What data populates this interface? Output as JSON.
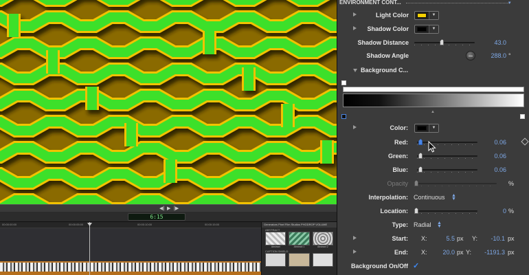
{
  "inspector": {
    "header": "ENVIRONMENT CONT...",
    "light_color": {
      "label": "Light Color",
      "color": "#f5d000"
    },
    "shadow_color": {
      "label": "Shadow Color",
      "color": "#000000"
    },
    "shadow_distance": {
      "label": "Shadow Distance",
      "value": "43.0",
      "slider_fraction": 0.46
    },
    "shadow_angle": {
      "label": "Shadow Angle",
      "value": "288.0",
      "unit": "°"
    },
    "background_color_section": {
      "label": "Background C..."
    },
    "color": {
      "label": "Color:",
      "color": "#000000"
    },
    "red": {
      "label": "Red:",
      "value": "0.06",
      "slider_fraction": 0.06
    },
    "green": {
      "label": "Green:",
      "value": "0.06",
      "slider_fraction": 0.06
    },
    "blue": {
      "label": "Blue:",
      "value": "0.06",
      "slider_fraction": 0.06
    },
    "opacity": {
      "label": "Opacity",
      "unit": "%"
    },
    "interpolation": {
      "label": "Interpolation:",
      "value": "Continuous"
    },
    "location": {
      "label": "Location:",
      "value": "0",
      "unit": "%"
    },
    "type": {
      "label": "Type:",
      "value": "Radial"
    },
    "start": {
      "label": "Start:",
      "x_label": "X:",
      "x": "5.5",
      "y_label": "Y:",
      "y": "-10.1",
      "unit": "px"
    },
    "end": {
      "label": "End:",
      "x_label": "X:",
      "x": "20.0",
      "y_label": "Y:",
      "y": "-1191.3",
      "unit": "px"
    },
    "background_onoff": {
      "label": "Background On/Off",
      "checked": true
    }
  },
  "viewer": {
    "timecode": "6:15",
    "colors": {
      "pattern": "#3ee02a",
      "edge": "#f2c200",
      "shadow": "#1a1400"
    }
  },
  "browser": {
    "header": "Generators   Pixel Film Studios  PHODROP VOLUME",
    "section1": "ABSTRACT",
    "thumbs": [
      "Abstract",
      "Abstract 1",
      "Abstract 2"
    ],
    "section2": "CAPTION SHIELD"
  },
  "icons": {
    "play": "play-icon",
    "prev": "previous-frame-icon",
    "next": "next-frame-icon",
    "keyframe": "keyframe-diamond-icon",
    "checkbox": "checkmark-icon",
    "cursor": "mouse-pointer-icon"
  }
}
